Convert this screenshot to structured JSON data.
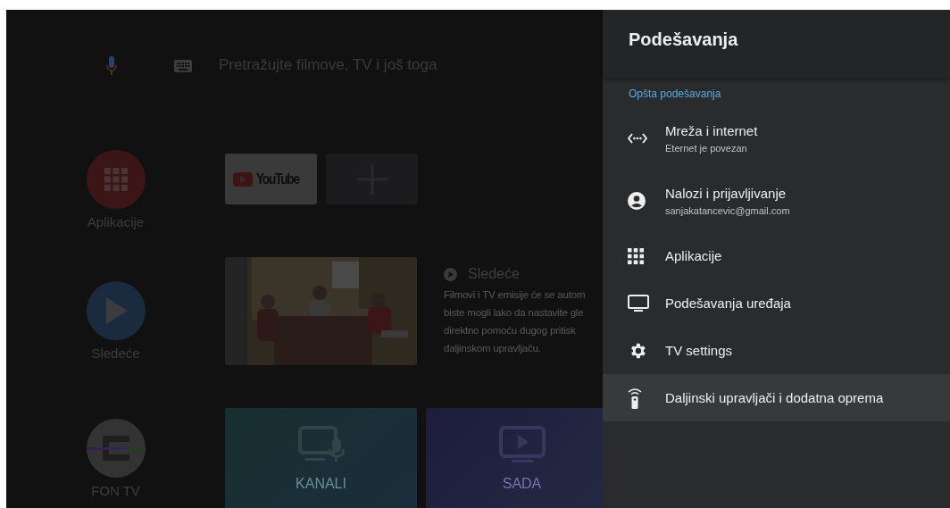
{
  "search": {
    "placeholder": "Pretražujte filmove, TV i još toga"
  },
  "side_items": [
    {
      "label": "Aplikacije"
    },
    {
      "label": "Sledeće"
    },
    {
      "label": "FON TV"
    }
  ],
  "app_tiles": [
    {
      "label": "YouTube"
    }
  ],
  "next_up": {
    "title": "Sledeće",
    "lines": [
      "Filmovi i TV emisije će se autom",
      "biste mogli lako da nastavite gle",
      "direktno pomoću dugog pritisk",
      "daljinskom upravljaču."
    ]
  },
  "channel_tiles": [
    {
      "label": "KANALI"
    },
    {
      "label": "SADA"
    }
  ],
  "panel": {
    "title": "Podešavanja",
    "section": "Opšta podešavanja",
    "items": [
      {
        "title": "Mreža i internet",
        "subtitle": "Eternet je povezan",
        "selected": false
      },
      {
        "title": "Nalozi i prijavljivanje",
        "subtitle": "sanjakatancevic@gmail.com",
        "selected": false
      },
      {
        "title": "Aplikacije",
        "selected": false
      },
      {
        "title": "Podešavanja uređaja",
        "selected": false
      },
      {
        "title": "TV settings",
        "selected": false
      },
      {
        "title": "Daljinski upravljači i dodatna oprema",
        "selected": true
      }
    ]
  }
}
